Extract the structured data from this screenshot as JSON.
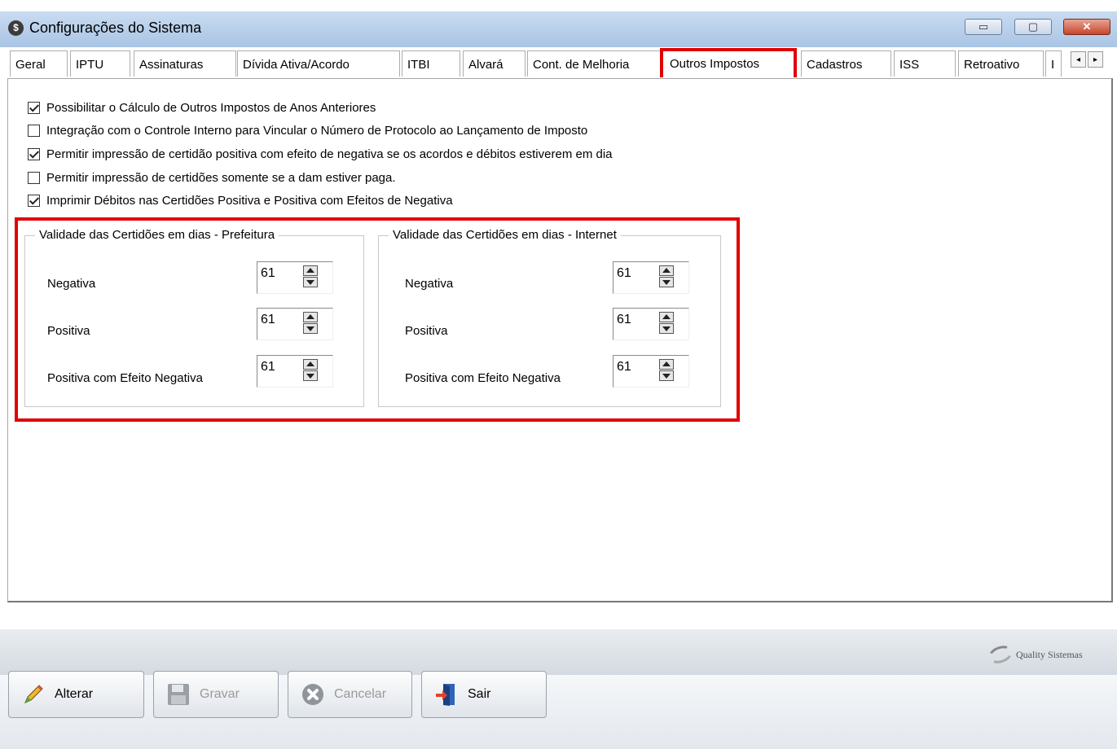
{
  "window": {
    "title": "Configurações do Sistema",
    "icon": "app-logo-icon",
    "minimize": "▭",
    "maximize": "▢",
    "close": "✕"
  },
  "tabs": [
    {
      "label": "Geral"
    },
    {
      "label": "IPTU"
    },
    {
      "label": "Assinaturas"
    },
    {
      "label": "Dívida Ativa/Acordo"
    },
    {
      "label": "ITBI"
    },
    {
      "label": "Alvará"
    },
    {
      "label": "Cont. de Melhoria"
    },
    {
      "label": "Outros Impostos",
      "active": true
    },
    {
      "label": "Cadastros"
    },
    {
      "label": "ISS"
    },
    {
      "label": "Retroativo"
    },
    {
      "label": "I"
    }
  ],
  "tab_scroll": {
    "left": "◂",
    "right": "▸"
  },
  "options": [
    {
      "label": "Possibilitar o Cálculo de Outros Impostos de Anos Anteriores",
      "checked": true
    },
    {
      "label": "Integração com o Controle Interno para Vincular o Número de Protocolo ao Lançamento de Imposto",
      "checked": false
    },
    {
      "label": "Permitir impressão de certidão positiva com efeito de negativa se os acordos e débitos estiverem em dia",
      "checked": true
    },
    {
      "label": "Permitir impressão de certidões somente se a dam estiver paga.",
      "checked": false
    },
    {
      "label": "Imprimir Débitos nas Certidões Positiva e Positiva com Efeitos de Negativa",
      "checked": true
    }
  ],
  "groups": [
    {
      "title": "Validade das Certidões em dias - Prefeitura",
      "fields": [
        {
          "label": "Negativa",
          "value": "61"
        },
        {
          "label": "Positiva",
          "value": "61"
        },
        {
          "label": "Positiva com Efeito Negativa",
          "value": "61"
        }
      ]
    },
    {
      "title": "Validade das Certidões em dias - Internet",
      "fields": [
        {
          "label": "Negativa",
          "value": "61"
        },
        {
          "label": "Positiva",
          "value": "61"
        },
        {
          "label": "Positiva com Efeito Negativa",
          "value": "61"
        }
      ]
    }
  ],
  "brand": {
    "name": "Quality Sistemas"
  },
  "toolbar": {
    "alterar": "Alterar",
    "gravar": "Gravar",
    "cancelar": "Cancelar",
    "sair": "Sair"
  },
  "colors": {
    "highlight": "#e00000",
    "titlebar": "#b9d0ec",
    "close": "#c8452b"
  }
}
